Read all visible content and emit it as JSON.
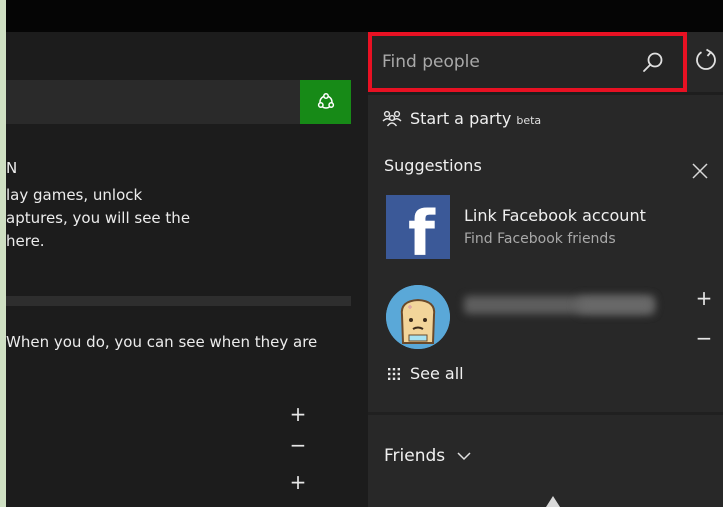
{
  "search": {
    "placeholder": "Find people"
  },
  "party": {
    "label": "Start a party",
    "beta": "beta"
  },
  "suggestions": {
    "title": "Suggestions",
    "items": [
      {
        "title": "Link Facebook account",
        "subtitle": "Find Facebook friends",
        "logo_letter": "f"
      }
    ]
  },
  "see_all": {
    "label": "See all"
  },
  "friends": {
    "label": "Friends"
  },
  "left": {
    "lines": [
      "N",
      "lay games, unlock",
      "aptures, you will see the",
      "here.",
      "When you do, you can see when they are"
    ]
  },
  "icons": [
    "search-icon",
    "refresh-icon",
    "party-icon",
    "close-icon",
    "grid-icon",
    "chevron-down-icon",
    "lfg-icon",
    "plus-icon",
    "minus-icon",
    "facebook-logo"
  ],
  "colors": {
    "accent_green": "#178a17",
    "highlight_red": "#e81123",
    "facebook_blue": "#3b5998"
  }
}
